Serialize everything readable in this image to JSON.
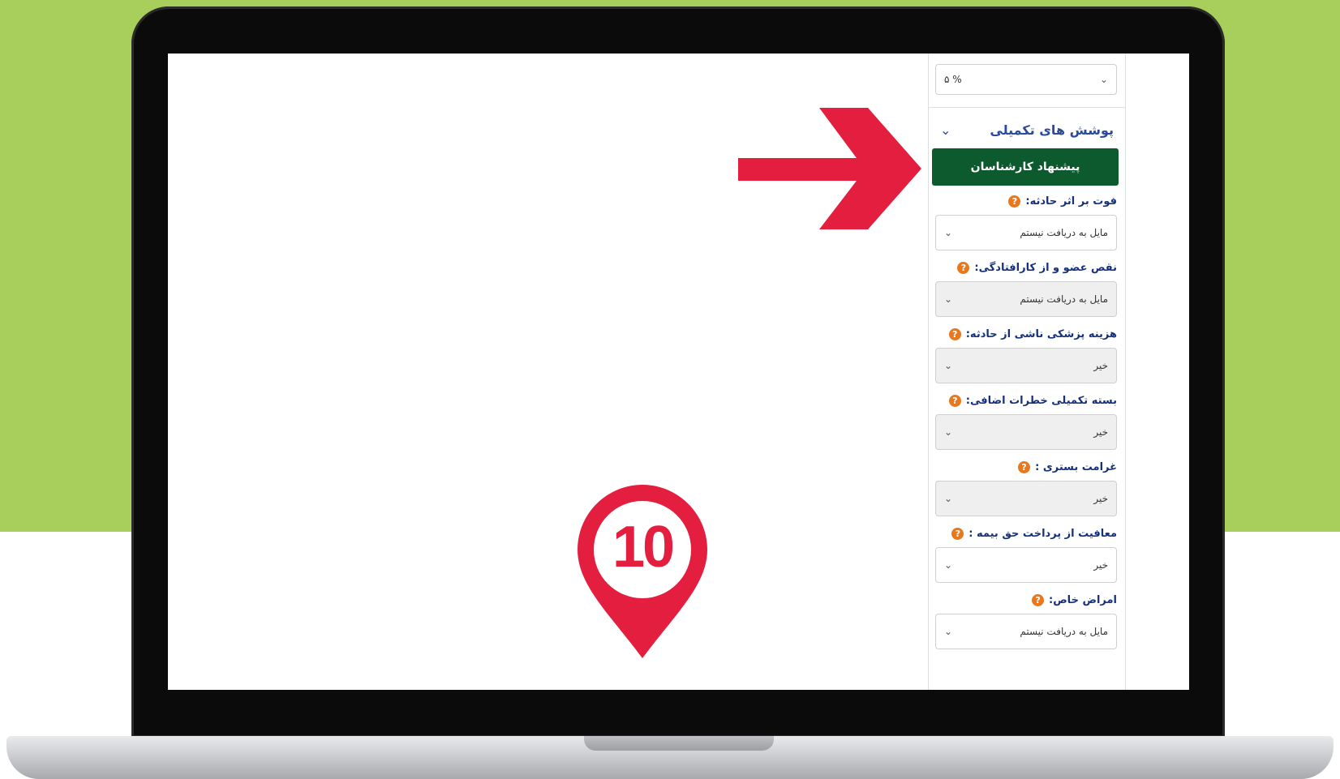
{
  "colors": {
    "background_green": "#a8cf5b",
    "accent_red": "#e31e3f",
    "button_green": "#0e5a2f",
    "label_blue": "#16317a",
    "help_orange": "#e8781e"
  },
  "top_select": {
    "value": "۵ %",
    "icon": "chevron-down-icon"
  },
  "section": {
    "title": "پوشش های تکمیلی",
    "toggle_icon": "chevron-down-icon"
  },
  "suggest_button": {
    "label": "پیشنهاد کارشناسان"
  },
  "fields": [
    {
      "label": "فوت بر اثر حادثه:",
      "value": "مایل به دریافت نیستم"
    },
    {
      "label": "نقص عضو و از کارافتادگی:",
      "value": "مایل به دریافت نیستم"
    },
    {
      "label": "هزینه پزشکی ناشی از حادثه:",
      "value": "خیر"
    },
    {
      "label": "بسته تکمیلی خطرات اضافی:",
      "value": "خیر"
    },
    {
      "label": "غرامت بستری :",
      "value": "خیر"
    },
    {
      "label": "معافیت از پرداخت حق بیمه :",
      "value": "خیر"
    },
    {
      "label": "امراض خاص:",
      "value": "مایل به دریافت نیستم"
    }
  ],
  "help_glyph": "?",
  "step_marker": {
    "number": "10",
    "icon": "location-pin-icon"
  },
  "pointer": {
    "icon": "arrow-right-icon"
  }
}
